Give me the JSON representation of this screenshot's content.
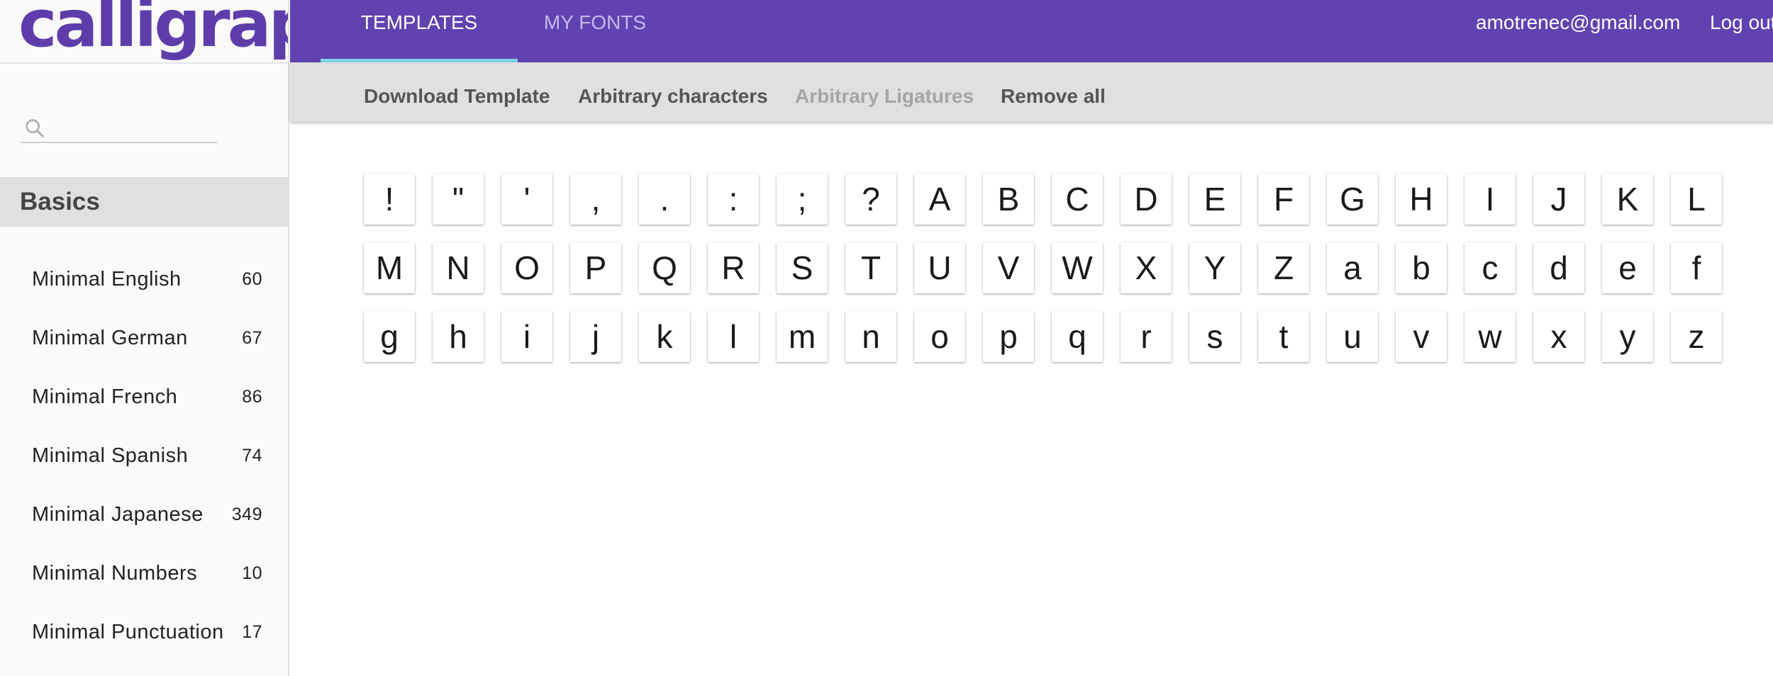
{
  "app": {
    "logo_text": "calligraphr",
    "brand_color": "#6241b1",
    "accent_color": "#7fd3e6"
  },
  "header": {
    "tabs": [
      {
        "label": "TEMPLATES",
        "active": true
      },
      {
        "label": "MY FONTS",
        "active": false
      }
    ],
    "user_email": "amotrenec@gmail.com",
    "logout_label": "Log out"
  },
  "toolbar": {
    "download_label": "Download Template",
    "arbitrary_characters_label": "Arbitrary characters",
    "arbitrary_ligatures_label": "Arbitrary Ligatures",
    "remove_all_label": "Remove all"
  },
  "sidebar": {
    "search": {
      "placeholder": "",
      "icon": "search-icon"
    },
    "category": "Basics",
    "templates": [
      {
        "name": "Minimal English",
        "count": "60"
      },
      {
        "name": "Minimal German",
        "count": "67"
      },
      {
        "name": "Minimal French",
        "count": "86"
      },
      {
        "name": "Minimal Spanish",
        "count": "74"
      },
      {
        "name": "Minimal Japanese",
        "count": "349"
      },
      {
        "name": "Minimal Numbers",
        "count": "10"
      },
      {
        "name": "Minimal Punctuation",
        "count": "17"
      }
    ]
  },
  "characters": [
    "!",
    "\"",
    "'",
    ",",
    ".",
    ":",
    ";",
    "?",
    "A",
    "B",
    "C",
    "D",
    "E",
    "F",
    "G",
    "H",
    "I",
    "J",
    "K",
    "L",
    "M",
    "N",
    "O",
    "P",
    "Q",
    "R",
    "S",
    "T",
    "U",
    "V",
    "W",
    "X",
    "Y",
    "Z",
    "a",
    "b",
    "c",
    "d",
    "e",
    "f",
    "g",
    "h",
    "i",
    "j",
    "k",
    "l",
    "m",
    "n",
    "o",
    "p",
    "q",
    "r",
    "s",
    "t",
    "u",
    "v",
    "w",
    "x",
    "y",
    "z"
  ]
}
